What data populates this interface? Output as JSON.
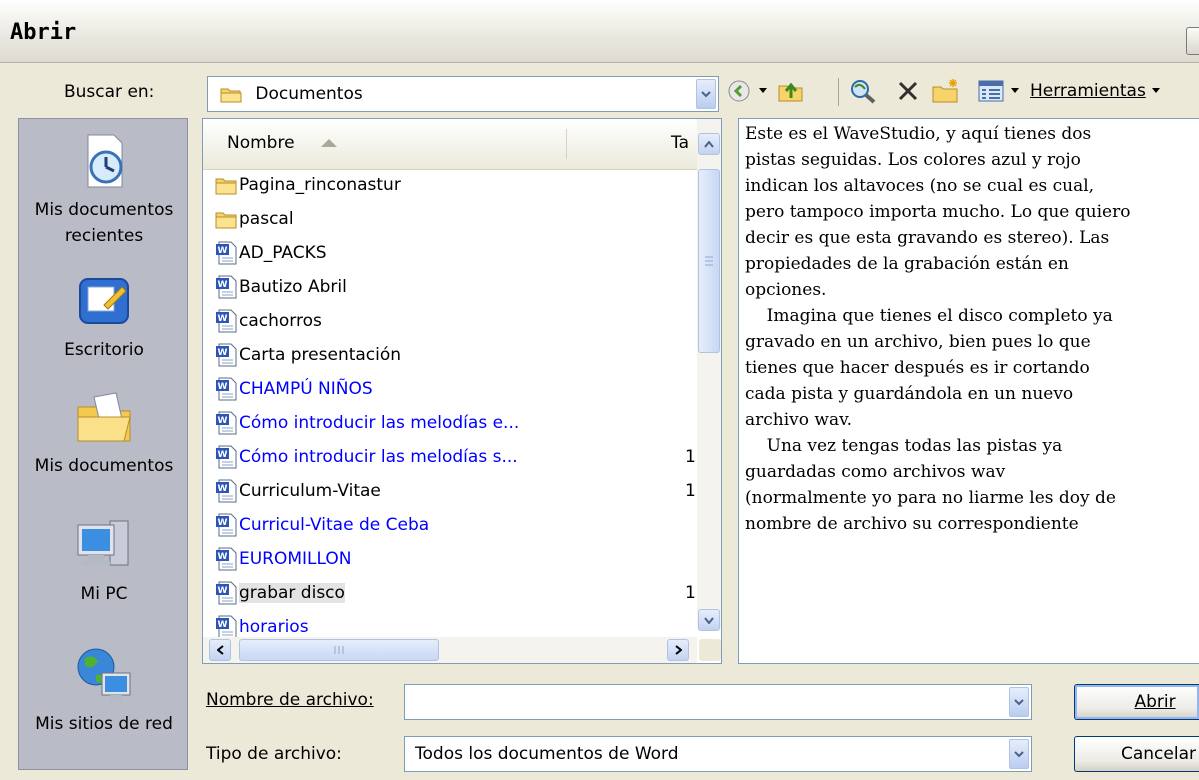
{
  "window": {
    "title": "Abrir"
  },
  "look_in": {
    "label": "Buscar en:",
    "value": "Documentos"
  },
  "toolbar": {
    "tools_label": "Herramientas"
  },
  "places": [
    {
      "label1": "Mis documentos",
      "label2": "recientes",
      "icon": "recent-documents-icon"
    },
    {
      "label1": "Escritorio",
      "label2": "",
      "icon": "desktop-icon"
    },
    {
      "label1": "Mis documentos",
      "label2": "",
      "icon": "my-documents-icon"
    },
    {
      "label1": "Mi PC",
      "label2": "",
      "icon": "my-computer-icon"
    },
    {
      "label1": "Mis sitios de red",
      "label2": "",
      "icon": "network-places-icon"
    }
  ],
  "filelist": {
    "columns": {
      "name": "Nombre",
      "size": "Ta"
    },
    "files": [
      {
        "name": "Pagina_rinconastur",
        "type": "folder",
        "color": "black",
        "size": ""
      },
      {
        "name": "pascal",
        "type": "folder",
        "color": "black",
        "size": ""
      },
      {
        "name": "AD_PACKS",
        "type": "word",
        "color": "black",
        "size": ""
      },
      {
        "name": "Bautizo Abril",
        "type": "word",
        "color": "black",
        "size": ""
      },
      {
        "name": "cachorros",
        "type": "word",
        "color": "black",
        "size": ""
      },
      {
        "name": "Carta presentación",
        "type": "word",
        "color": "black",
        "size": ""
      },
      {
        "name": "CHAMPÚ   NIÑOS",
        "type": "word",
        "color": "blue",
        "size": ""
      },
      {
        "name": "Cómo introducir las melodías e...",
        "type": "word",
        "color": "blue",
        "size": ""
      },
      {
        "name": "Cómo introducir las melodías s...",
        "type": "word",
        "color": "blue",
        "size": "1"
      },
      {
        "name": "Curriculum-Vitae",
        "type": "word",
        "color": "black",
        "size": "1"
      },
      {
        "name": "Curricul-Vitae de Ceba",
        "type": "word",
        "color": "blue",
        "size": ""
      },
      {
        "name": "EUROMILLON",
        "type": "word",
        "color": "blue",
        "size": ""
      },
      {
        "name": "grabar disco",
        "type": "word",
        "color": "black",
        "size": "1",
        "selected": true
      },
      {
        "name": "horarios",
        "type": "word",
        "color": "blue",
        "size": ""
      }
    ]
  },
  "preview": {
    "lines": [
      "Este es el WaveStudio, y aquí tienes dos",
      "pistas seguidas. Los colores azul y rojo",
      "indican los altavoces (no se cual es cual,",
      "pero tampoco importa mucho. Lo que quiero",
      "decir es que esta gravando es stereo). Las",
      "propiedades de la grabación están en",
      "opciones.",
      "",
      "",
      "    Imagina que tienes el disco completo ya",
      "gravado en un archivo, bien pues lo que",
      "tienes que hacer después es ir cortando",
      "cada pista y guardándola en un nuevo",
      "archivo wav.",
      "    Una vez tengas todas las pistas ya",
      "guardadas como archivos wav",
      "(normalmente yo para no liarme les doy de",
      "nombre de archivo su correspondiente"
    ]
  },
  "filename": {
    "label": "Nombre de archivo:",
    "value": ""
  },
  "filetype": {
    "label": "Tipo de archivo:",
    "value": "Todos los documentos de Word"
  },
  "buttons": {
    "open": "Abrir",
    "cancel": "Cancelar"
  }
}
